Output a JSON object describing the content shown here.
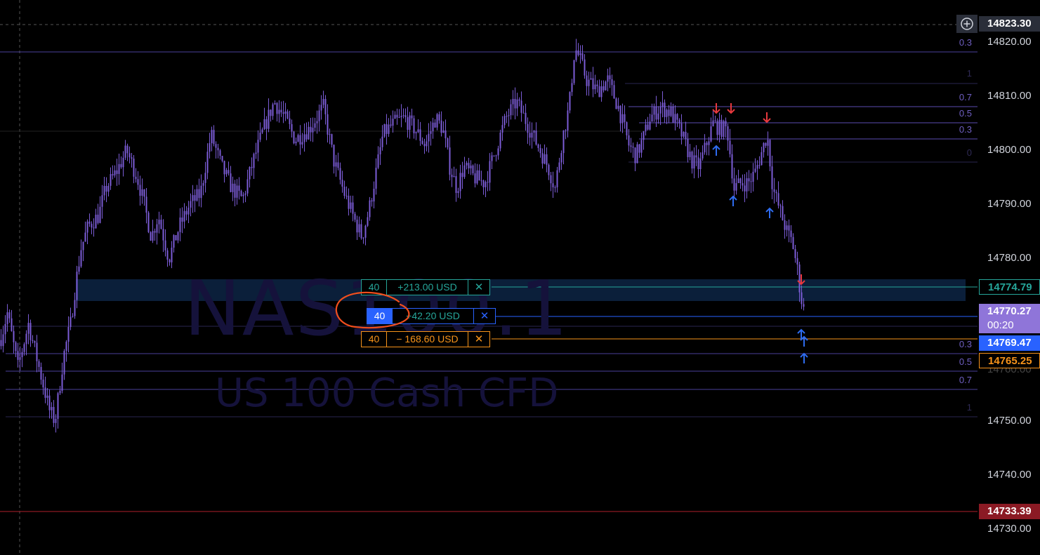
{
  "symbol": {
    "name": "NAS100.1",
    "description": "US 100 Cash CFD"
  },
  "price_axis": {
    "labels": [
      "14820.00",
      "14810.00",
      "14800.00",
      "14790.00",
      "14780.00",
      "14760.00",
      "14750.00",
      "14740.00",
      "14730.00"
    ],
    "crosshair_price": "14823.30",
    "current_price": "14770.27",
    "countdown": "00:20",
    "take_profit_price": "14774.79",
    "entry_price": "14769.47",
    "stop_loss_price": "14765.25",
    "alert_price": "14733.39"
  },
  "orders": {
    "take_profit": {
      "qty": "40",
      "pnl": "+213.00 USD",
      "close": "✕"
    },
    "position": {
      "qty": "40",
      "pnl": "+42.20 USD",
      "close": "✕"
    },
    "stop_loss": {
      "qty": "40",
      "pnl": "− 168.60 USD",
      "close": "✕"
    }
  },
  "fib_upper": [
    "0.3",
    "1",
    "0.7",
    "0.5",
    "0.3",
    "0"
  ],
  "fib_lower": [
    "0.3",
    "0.5",
    "0.7",
    "1"
  ],
  "colors": {
    "candle": "#7b5cd6",
    "take_profit": "#26a69a",
    "position": "#2962ff",
    "stop_loss": "#f7931a",
    "alert": "#8b1a24",
    "fib": "#6f5fc2",
    "sell_arrow": "#e8383d",
    "buy_arrow": "#2e6cf0",
    "annotation": "#f04e1d"
  },
  "icons": {
    "add": "plus-circle-icon",
    "close": "close-icon"
  },
  "chart_data": {
    "type": "candlestick",
    "y_range": [
      14725,
      14826
    ],
    "price_anchors": [
      [
        0,
        14765
      ],
      [
        10,
        14770
      ],
      [
        25,
        14760
      ],
      [
        40,
        14768
      ],
      [
        55,
        14760
      ],
      [
        70,
        14752
      ],
      [
        78,
        14750
      ],
      [
        90,
        14762
      ],
      [
        100,
        14768
      ],
      [
        108,
        14776
      ],
      [
        115,
        14782
      ],
      [
        125,
        14786
      ],
      [
        140,
        14788
      ],
      [
        150,
        14793
      ],
      [
        165,
        14796
      ],
      [
        180,
        14800
      ],
      [
        195,
        14795
      ],
      [
        205,
        14790
      ],
      [
        215,
        14784
      ],
      [
        225,
        14788
      ],
      [
        240,
        14780
      ],
      [
        255,
        14786
      ],
      [
        270,
        14790
      ],
      [
        285,
        14792
      ],
      [
        300,
        14803
      ],
      [
        315,
        14797
      ],
      [
        330,
        14793
      ],
      [
        345,
        14791
      ],
      [
        360,
        14798
      ],
      [
        375,
        14804
      ],
      [
        390,
        14809
      ],
      [
        405,
        14806
      ],
      [
        420,
        14802
      ],
      [
        440,
        14804
      ],
      [
        460,
        14808
      ],
      [
        475,
        14798
      ],
      [
        490,
        14792
      ],
      [
        505,
        14787
      ],
      [
        515,
        14784
      ],
      [
        525,
        14789
      ],
      [
        535,
        14796
      ],
      [
        545,
        14803
      ],
      [
        560,
        14805
      ],
      [
        575,
        14806
      ],
      [
        590,
        14804
      ],
      [
        605,
        14801
      ],
      [
        620,
        14806
      ],
      [
        630,
        14804
      ],
      [
        640,
        14797
      ],
      [
        650,
        14793
      ],
      [
        660,
        14797
      ],
      [
        675,
        14795
      ],
      [
        690,
        14794
      ],
      [
        705,
        14800
      ],
      [
        720,
        14806
      ],
      [
        735,
        14809
      ],
      [
        750,
        14805
      ],
      [
        765,
        14801
      ],
      [
        780,
        14797
      ],
      [
        790,
        14793
      ],
      [
        800,
        14802
      ],
      [
        810,
        14808
      ],
      [
        818,
        14819
      ],
      [
        825,
        14817
      ],
      [
        835,
        14813
      ],
      [
        850,
        14811
      ],
      [
        865,
        14813
      ],
      [
        880,
        14808
      ],
      [
        895,
        14801
      ],
      [
        905,
        14799
      ],
      [
        915,
        14802
      ],
      [
        925,
        14806
      ],
      [
        940,
        14808
      ],
      [
        955,
        14807
      ],
      [
        970,
        14803
      ],
      [
        985,
        14798
      ],
      [
        995,
        14797
      ],
      [
        1005,
        14801
      ],
      [
        1015,
        14805
      ],
      [
        1025,
        14804
      ],
      [
        1035,
        14804
      ],
      [
        1045,
        14793
      ],
      [
        1055,
        14794
      ],
      [
        1065,
        14794
      ],
      [
        1075,
        14796
      ],
      [
        1085,
        14800
      ],
      [
        1092,
        14803
      ],
      [
        1100,
        14793
      ],
      [
        1110,
        14789
      ],
      [
        1120,
        14785
      ],
      [
        1128,
        14783
      ],
      [
        1135,
        14778
      ],
      [
        1140,
        14773
      ],
      [
        1145,
        14770
      ]
    ]
  }
}
